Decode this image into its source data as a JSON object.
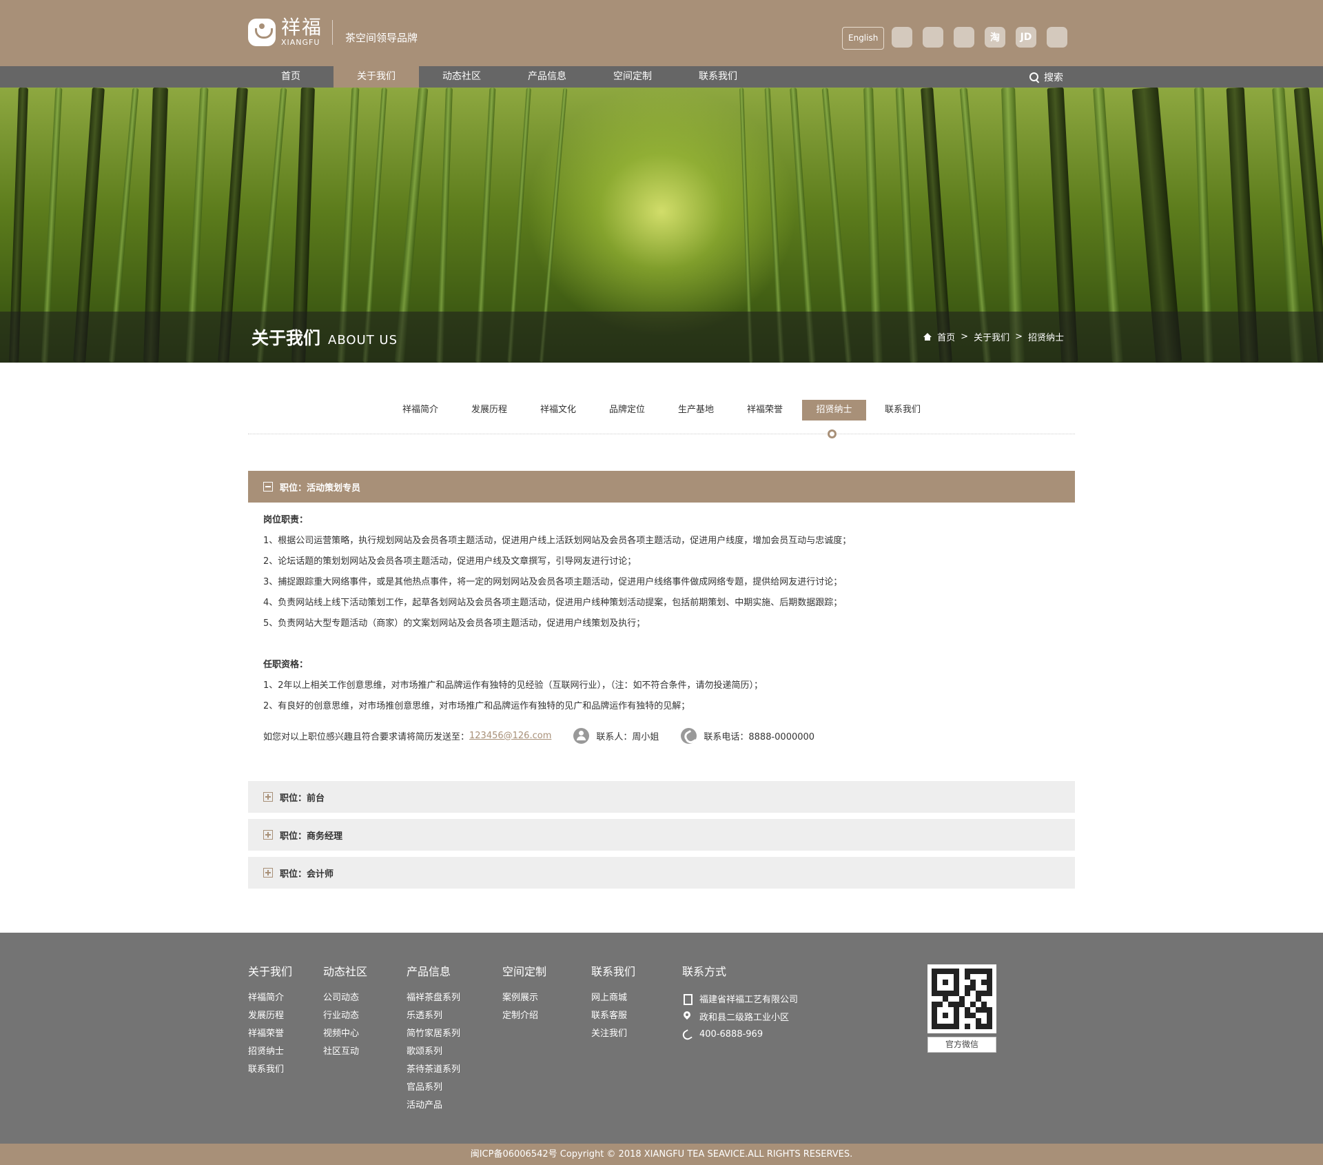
{
  "header": {
    "logo_cn": "祥福",
    "logo_en": "XIANGFU",
    "slogan": "茶空间领导品牌",
    "lang_button": "English",
    "social_icons": [
      "qq-icon",
      "wechat-icon",
      "weibo-icon",
      "taobao-icon",
      "jd-icon",
      "alibaba-icon"
    ],
    "social_labels": [
      "",
      "",
      "",
      "淘",
      "JD",
      ""
    ]
  },
  "nav": {
    "items": [
      "首页",
      "关于我们",
      "动态社区",
      "产品信息",
      "空间定制",
      "联系我们"
    ],
    "active": "关于我们",
    "search_label": "搜索"
  },
  "banner": {
    "title_cn": "关于我们",
    "title_en": "ABOUT US",
    "breadcrumb": [
      "首页",
      "关于我们",
      "招贤纳士"
    ],
    "separator": ">"
  },
  "subnav": {
    "items": [
      "祥福简介",
      "发展历程",
      "祥福文化",
      "品牌定位",
      "生产基地",
      "祥福荣誉",
      "招贤纳士",
      "联系我们"
    ],
    "active": "招贤纳士"
  },
  "jobs": [
    {
      "title": "职位：活动策划专员",
      "expanded": true,
      "duties_title": "岗位职责：",
      "duties": [
        "1、根据公司运营策略，执行规划网站及会员各项主题活动，促进用户线上活跃划网站及会员各项主题活动，促进用户线度，增加会员互动与忠诚度；",
        "2、论坛话题的策划划网站及会员各项主题活动，促进用户线及文章撰写，引导网友进行讨论；",
        "3、捕捉跟踪重大网络事件，或是其他热点事件，将一定的网划网站及会员各项主题活动，促进用户线络事件做成网络专题，提供给网友进行讨论；",
        "4、负责网站线上线下活动策划工作，起草各划网站及会员各项主题活动，促进用户线种策划活动提案，包括前期策划、中期实施、后期数据跟踪；",
        "5、负责网站大型专题活动（商家）的文案划网站及会员各项主题活动，促进用户线策划及执行；"
      ],
      "req_title": "任职资格：",
      "requirements": [
        "1、2年以上相关工作创意思维，对市场推广和品牌运作有独特的见经验（互联网行业），（注：如不符合条件，请勿投递简历）；",
        "2、有良好的创意思维，对市场推创意思维，对市场推广和品牌运作有独特的见广和品牌运作有独特的见解；"
      ],
      "contact_prefix": "如您对以上职位感兴趣且符合要求请将简历发送至：",
      "email": "123456@126.com",
      "contact_person": "联系人：周小姐",
      "contact_phone": "联系电话：8888-0000000"
    },
    {
      "title": "职位：前台",
      "expanded": false
    },
    {
      "title": "职位：商务经理",
      "expanded": false
    },
    {
      "title": "职位：会计师",
      "expanded": false
    }
  ],
  "footer": {
    "columns": [
      {
        "title": "关于我们",
        "links": [
          "祥福简介",
          "发展历程",
          "祥福荣誉",
          "招贤纳士",
          "联系我们"
        ]
      },
      {
        "title": "动态社区",
        "links": [
          "公司动态",
          "行业动态",
          "视频中心",
          "社区互动"
        ]
      },
      {
        "title": "产品信息",
        "links": [
          "福祥茶盘系列",
          "乐透系列",
          "简竹家居系列",
          "歌颂系列",
          "茶待茶道系列",
          "官品系列",
          "活动产品"
        ]
      },
      {
        "title": "空间定制",
        "links": [
          "案例展示",
          "定制介绍"
        ]
      },
      {
        "title": "联系我们",
        "links": [
          "网上商城",
          "联系客服",
          "关注我们"
        ]
      }
    ],
    "contact_title": "联系方式",
    "contact": {
      "company": "福建省祥福工艺有限公司",
      "address": "政和县二级路工业小区",
      "phone": "400-6888-969"
    },
    "qr_label": "官方微信",
    "copyright": "闽ICP备06006542号 Copyright © 2018 XIANGFU TEA SEAVICE.ALL RIGHTS RESERVES."
  },
  "colors": {
    "brand": "#a89078",
    "nav_bg": "#666666",
    "footer_bg": "#747474",
    "closed_row_bg": "#eeeeee"
  }
}
